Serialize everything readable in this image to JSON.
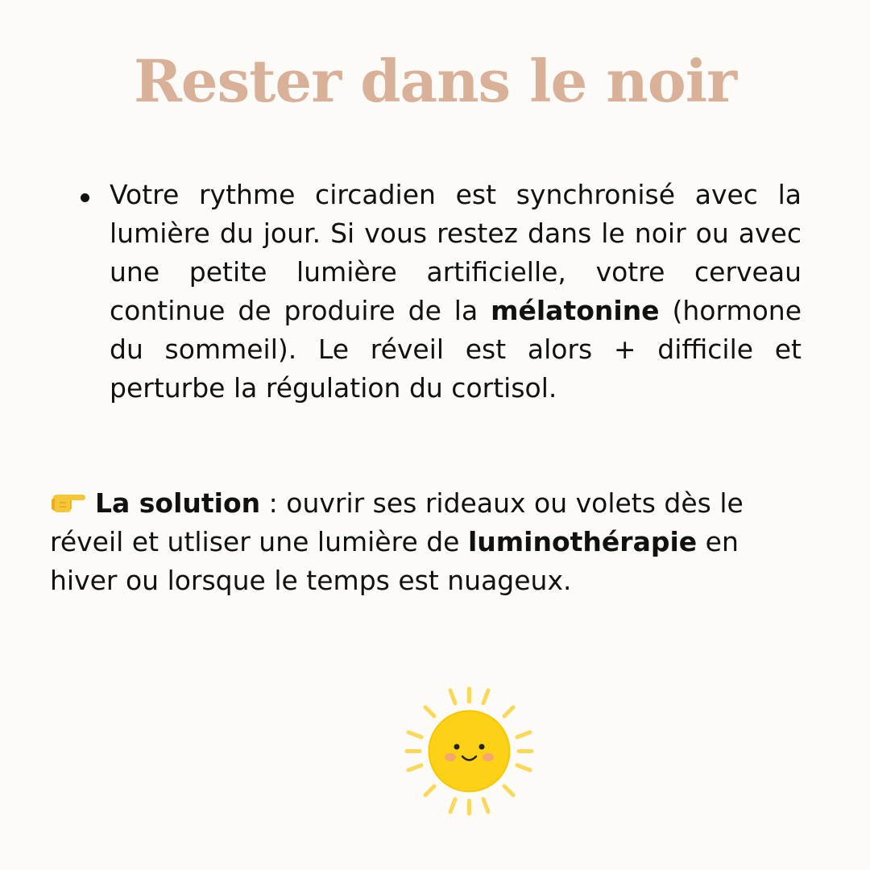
{
  "title": "Rester dans le noir",
  "bullet": {
    "text_before": "Votre rythme circadien est synchronisé avec la lumière du jour. Si vous restez dans le noir ou avec une petite lumière artificielle, votre cerveau continue de produire de la ",
    "bold_term": "mélatonine",
    "text_after": " (hormone du sommeil). Le réveil est alors + difficile et perturbe la régulation du cortisol."
  },
  "solution": {
    "icon": "pointing-hand-icon",
    "label": "La solution",
    "text_1": " : ouvrir ses rideaux ou volets dès le réveil et utliser une lumière de ",
    "bold_term": "luminothérapie",
    "text_2": " en hiver ou lorsque le temps est nuageux."
  },
  "illustration": {
    "icon": "smiling-sun-icon"
  },
  "colors": {
    "background": "#fdfbf8",
    "title": "#d9b199",
    "text": "#111111",
    "sun": "#fcd116",
    "sun_rays": "#f9d85a",
    "cheeks": "#f5a07a"
  }
}
